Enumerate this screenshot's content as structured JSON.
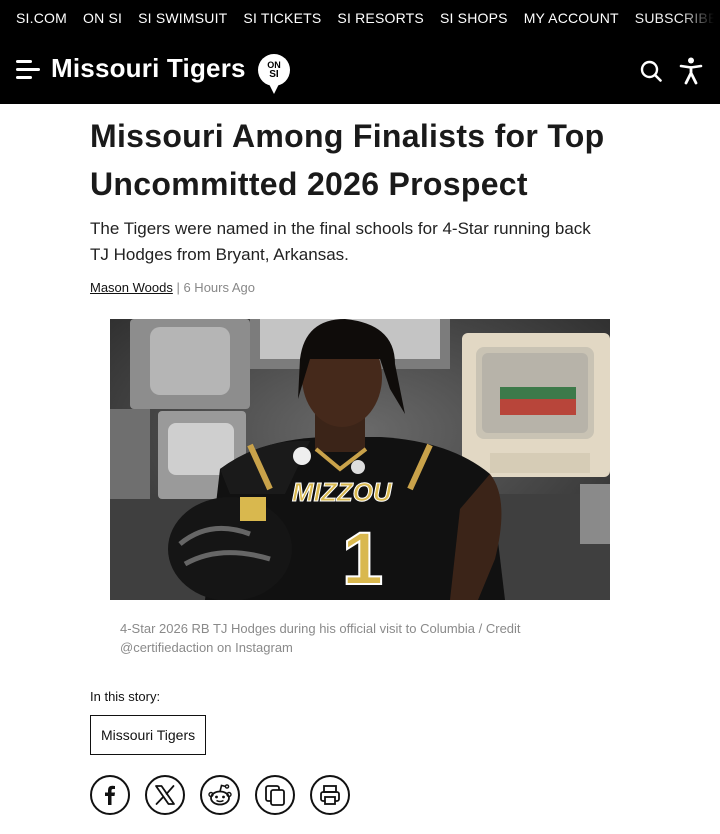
{
  "topnav": {
    "links": [
      "SI.COM",
      "ON SI",
      "SI SWIMSUIT",
      "SI TICKETS",
      "SI RESORTS",
      "SI SHOPS",
      "MY ACCOUNT",
      "SUBSCRIBE NOW"
    ]
  },
  "header": {
    "brand": "Missouri Tigers",
    "badge_top": "ON",
    "badge_bottom": "SI"
  },
  "article": {
    "headline": "Missouri Among Finalists for Top Uncommitted 2026 Prospect",
    "dek": "The Tigers were named in the final schools for 4-Star running back TJ Hodges from Bryant, Arkansas.",
    "author": "Mason Woods",
    "separator": " | ",
    "time": "6 Hours Ago",
    "photo": {
      "jersey_text": "MIZZOU",
      "jersey_number": "1"
    },
    "caption": "4-Star 2026 RB TJ Hodges during his official visit to Columbia / Credit @certifiedaction on Instagram"
  },
  "story": {
    "label": "In this story:",
    "tags": [
      "Missouri Tigers"
    ]
  },
  "share": {
    "icons": [
      "facebook-icon",
      "x-icon",
      "reddit-icon",
      "copy-icon",
      "print-icon"
    ]
  },
  "colors": {
    "header_bg": "#000000",
    "text": "#1a1a1a",
    "muted": "#888888"
  }
}
